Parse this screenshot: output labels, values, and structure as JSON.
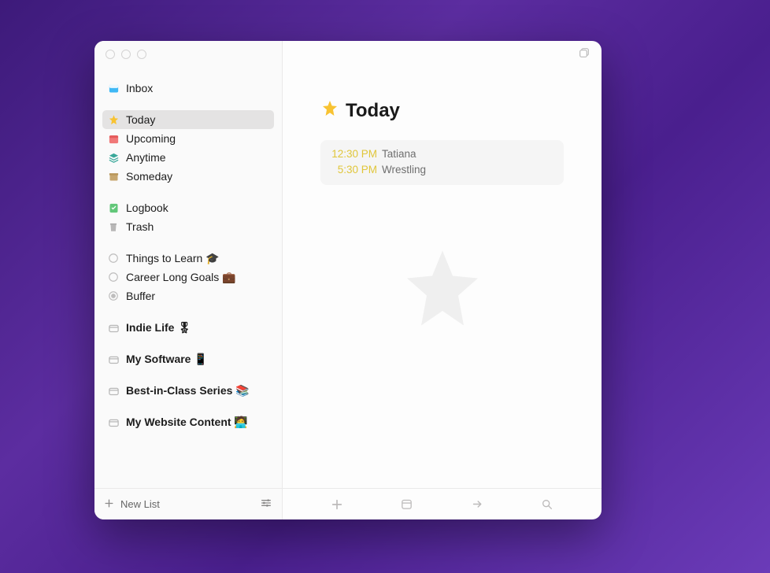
{
  "sidebar": {
    "inbox": "Inbox",
    "today": "Today",
    "upcoming": "Upcoming",
    "anytime": "Anytime",
    "someday": "Someday",
    "logbook": "Logbook",
    "trash": "Trash",
    "projects": [
      {
        "label": "Things to Learn 🎓"
      },
      {
        "label": "Career Long Goals 💼"
      },
      {
        "label": "Buffer"
      }
    ],
    "areas": [
      {
        "label": "Indie Life 🎖"
      },
      {
        "label": "My Software 📱"
      },
      {
        "label": "Best-in-Class Series 📚"
      },
      {
        "label": "My Website Content 🧑‍💻"
      }
    ],
    "new_list": "New List"
  },
  "main": {
    "title": "Today",
    "events": [
      {
        "time": "12:30 PM",
        "title": "Tatiana"
      },
      {
        "time": "5:30 PM",
        "title": "Wrestling"
      }
    ]
  }
}
